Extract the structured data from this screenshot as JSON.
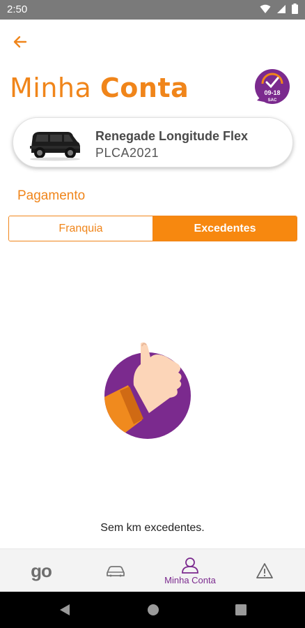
{
  "status_bar": {
    "time": "2:50"
  },
  "header": {
    "title_light": "Minha",
    "title_bold": "Conta",
    "sac_hours": "09-18",
    "sac_label": "SAC"
  },
  "vehicle": {
    "model": "Renegade Longitude Flex",
    "plate": "PLCA2021"
  },
  "payment": {
    "label": "Pagamento",
    "tabs": [
      {
        "label": "Franquia",
        "selected": false
      },
      {
        "label": "Excedentes",
        "selected": true
      }
    ]
  },
  "empty_state": {
    "message": "Sem km excedentes."
  },
  "bottom_nav": {
    "items": [
      {
        "label": "go",
        "icon": "go-logo"
      },
      {
        "label": "",
        "icon": "car-icon"
      },
      {
        "label": "Minha Conta",
        "icon": "user-icon",
        "active": true
      },
      {
        "label": "",
        "icon": "warning-icon"
      }
    ]
  },
  "colors": {
    "accent": "#f0851a",
    "purple": "#7b2a8e",
    "status_bar": "#7a7a7a"
  }
}
